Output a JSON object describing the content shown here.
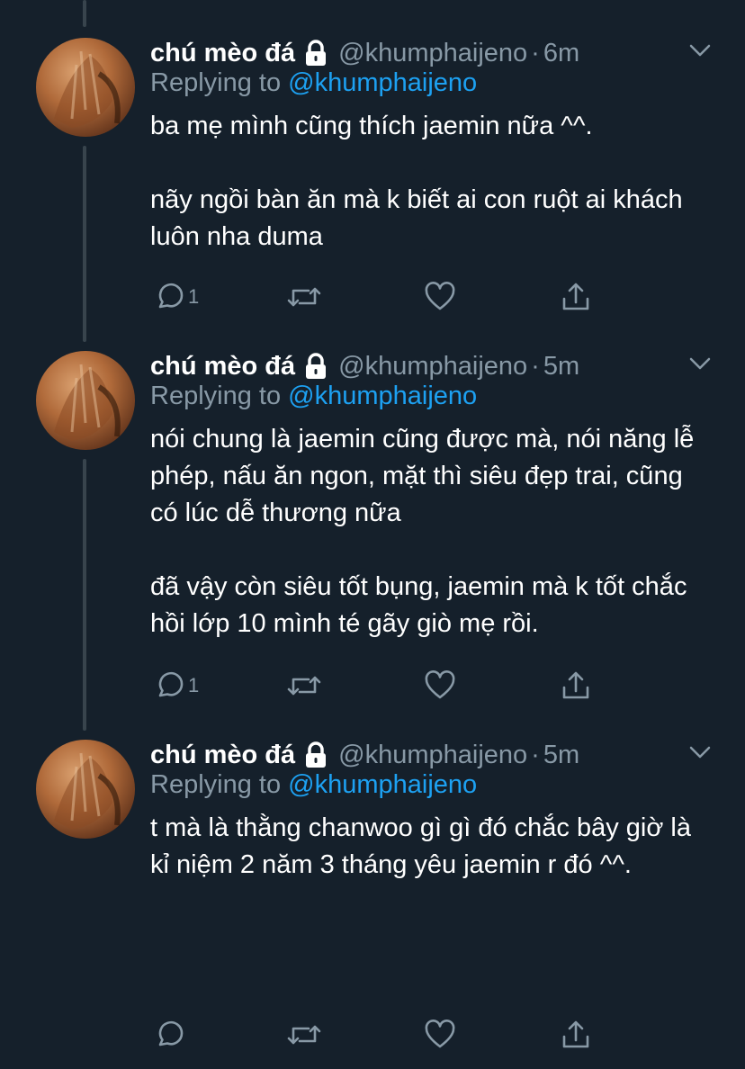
{
  "colors": {
    "background": "#15202b",
    "text_primary": "#ffffff",
    "text_secondary": "#8899a6",
    "accent": "#1da1f2",
    "thread_line": "#38444d"
  },
  "tweets": [
    {
      "name": "chú mèo đá",
      "lock_icon": "lock-icon",
      "handle": "@khumphaijeno",
      "separator": "·",
      "time": "6m",
      "replying_prefix": "Replying to",
      "replying_to": "@khumphaijeno",
      "text": "ba mẹ mình cũng thích jaemin nữa ^^.\n\nnãy ngồi bàn ăn mà k biết ai con ruột ai khách luôn nha duma",
      "reply_count": "1",
      "icons": [
        "reply-icon",
        "retweet-icon",
        "like-icon",
        "share-icon"
      ]
    },
    {
      "name": "chú mèo đá",
      "lock_icon": "lock-icon",
      "handle": "@khumphaijeno",
      "separator": "·",
      "time": "5m",
      "replying_prefix": "Replying to",
      "replying_to": "@khumphaijeno",
      "text": "nói chung là jaemin cũng được mà, nói năng lễ phép, nấu ăn ngon, mặt thì siêu đẹp trai, cũng có lúc dễ thương nữa\n\nđã vậy còn siêu tốt bụng, jaemin mà k tốt chắc hồi lớp 10 mình té gãy giò mẹ rồi.",
      "reply_count": "1",
      "icons": [
        "reply-icon",
        "retweet-icon",
        "like-icon",
        "share-icon"
      ]
    },
    {
      "name": "chú mèo đá",
      "lock_icon": "lock-icon",
      "handle": "@khumphaijeno",
      "separator": "·",
      "time": "5m",
      "replying_prefix": "Replying to",
      "replying_to": "@khumphaijeno",
      "text": "t mà là thằng chanwoo gì gì đó chắc bây giờ là kỉ niệm 2 năm 3 tháng yêu jaemin r đó ^^.",
      "reply_count": "",
      "icons": [
        "reply-icon",
        "retweet-icon",
        "like-icon",
        "share-icon"
      ]
    }
  ]
}
